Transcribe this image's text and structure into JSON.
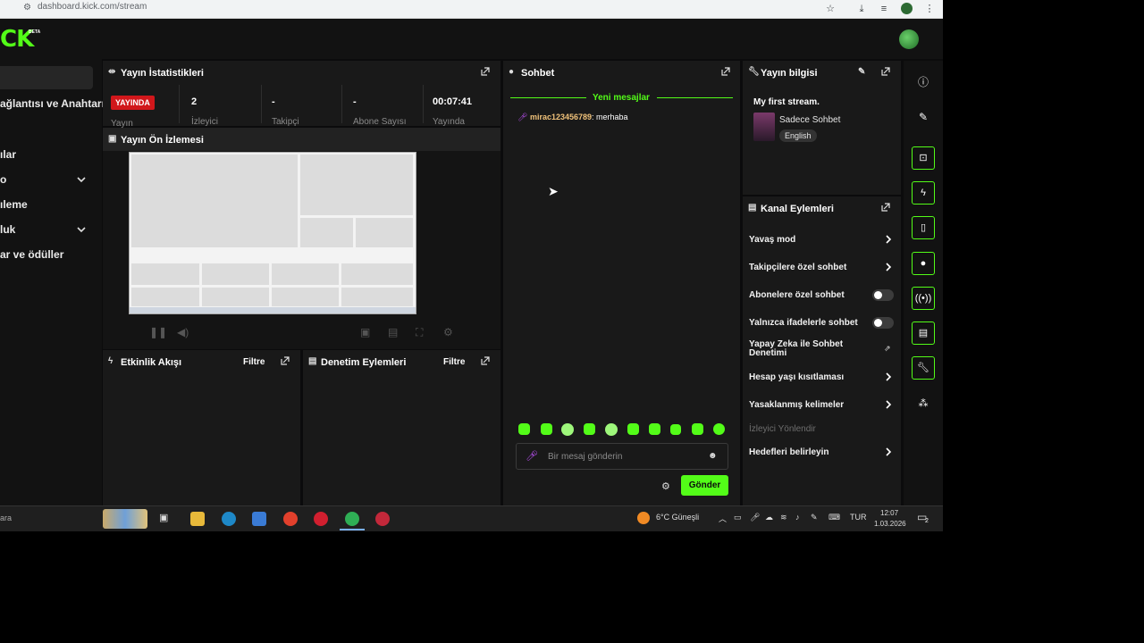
{
  "browser": {
    "url": "dashboard.kick.com/stream"
  },
  "topnav": {
    "logo": "CK",
    "beta": "BETA"
  },
  "sidebar": {
    "items": [
      {
        "label": "ağlantısı ve Anahtarı"
      },
      {
        "label": "ılar"
      },
      {
        "label": "o"
      },
      {
        "label": "ıleme"
      },
      {
        "label": "luk"
      },
      {
        "label": "ar ve ödüller"
      }
    ]
  },
  "stats": {
    "title": "Yayın İstatistikleri",
    "live_badge": "YAYINDA",
    "live_sub": "Yayın",
    "viewers_value": "2",
    "viewers_label": "İzleyici",
    "followers_value": "-",
    "followers_label": "Takipçi",
    "subs_value": "-",
    "subs_label": "Abone Sayısı",
    "duration_value": "00:07:41",
    "duration_label": "Yayında"
  },
  "preview": {
    "title": "Yayın Ön İzlemesi"
  },
  "activity": {
    "title": "Etkinlik Akışı",
    "filter": "Filtre"
  },
  "moderation": {
    "title": "Denetim Eylemleri",
    "filter": "Filtre"
  },
  "chat": {
    "title": "Sohbet",
    "new_messages": "Yeni mesajlar",
    "messages": [
      {
        "user": "mirac123456789",
        "text": ": merhaba"
      }
    ],
    "input_placeholder": "Bir mesaj gönderin",
    "send": "Gönder"
  },
  "streaminfo": {
    "title": "Yayın bilgisi",
    "stream_title": "My first stream.",
    "category": "Sadece Sohbet",
    "language": "English"
  },
  "channel_actions": {
    "title": "Kanal Eylemleri",
    "items": [
      {
        "label": "Yavaş mod"
      },
      {
        "label": "Takipçilere özel sohbet"
      },
      {
        "label": "Abonelere özel sohbet"
      },
      {
        "label": "Yalnızca ifadelerle sohbet"
      },
      {
        "label": "Yapay Zeka ile Sohbet Denetimi"
      },
      {
        "label": "Hesap yaşı kısıtlaması"
      },
      {
        "label": "Yasaklanmış kelimeler"
      },
      {
        "label": "İzleyici Yönlendir"
      },
      {
        "label": "Hedefleri belirleyin"
      }
    ]
  },
  "taskbar": {
    "search": "ara",
    "weather": "6°C  Güneşli",
    "lang": "TUR",
    "time": "12:07",
    "date": "1.03.2026",
    "notif_count": "2"
  },
  "colors": {
    "accent": "#53fc18",
    "live": "#d1171b",
    "panel": "#191919",
    "username": "#f0c27a"
  }
}
